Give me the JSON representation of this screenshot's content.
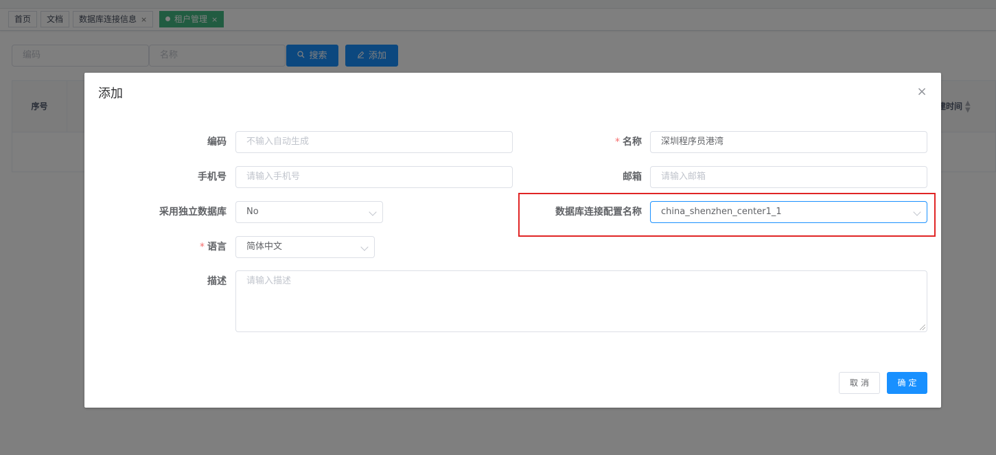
{
  "tags": [
    {
      "label": "首页",
      "closable": false,
      "active": false
    },
    {
      "label": "文档",
      "closable": false,
      "active": false
    },
    {
      "label": "数据库连接信息",
      "closable": true,
      "active": false
    },
    {
      "label": "租户管理",
      "closable": true,
      "active": true
    }
  ],
  "tag_close_glyph": "×",
  "search": {
    "code_placeholder": "编码",
    "name_placeholder": "名称",
    "search_label": "搜索",
    "add_label": "添加"
  },
  "table": {
    "col_index": "序号",
    "col_created": "建时间"
  },
  "dialog": {
    "title": "添加",
    "close_glyph": "×",
    "fields": {
      "code": {
        "label": "编码",
        "placeholder": "不输入自动生成"
      },
      "name": {
        "label": "名称",
        "value": "深圳程序员港湾",
        "required": "*"
      },
      "phone": {
        "label": "手机号",
        "placeholder": "请输入手机号"
      },
      "email": {
        "label": "邮箱",
        "placeholder": "请输入邮箱"
      },
      "standalone_db": {
        "label": "采用独立数据库",
        "value": "No"
      },
      "db_config": {
        "label": "数据库连接配置名称",
        "value": "china_shenzhen_center1_1"
      },
      "language": {
        "label": "语言",
        "value": "简体中文",
        "required": "*"
      },
      "description": {
        "label": "描述",
        "placeholder": "请输入描述"
      }
    },
    "cancel_label": "取消",
    "ok_label": "确定"
  },
  "colors": {
    "primary": "#1890ff",
    "active_tag": "#42b983",
    "highlight": "#e02424",
    "required": "#f56c6c"
  }
}
